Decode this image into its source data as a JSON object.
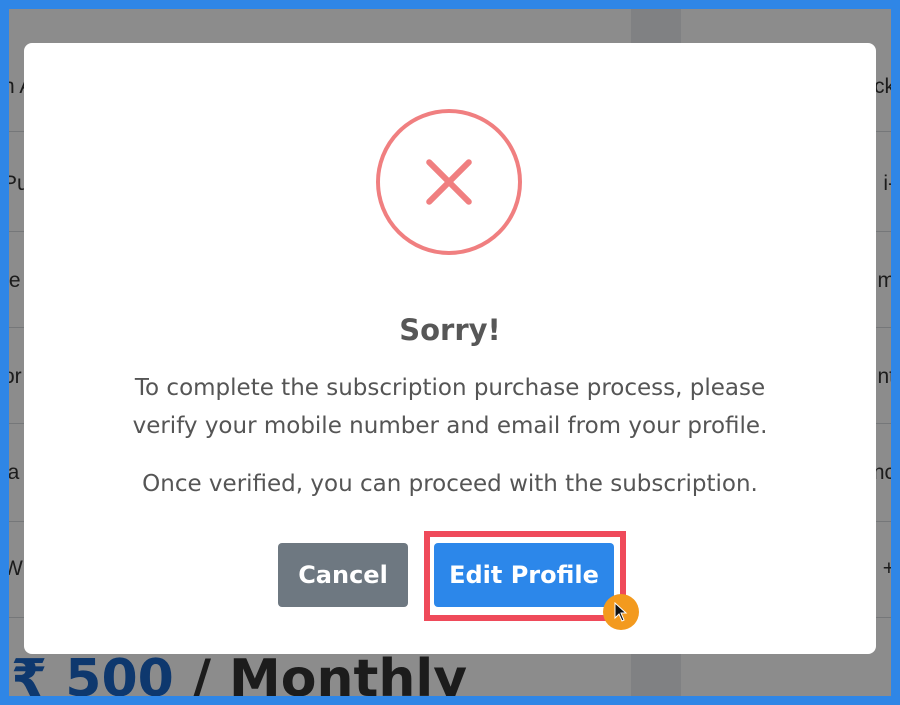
{
  "background": {
    "left_fragments": [
      "n A",
      "Pu",
      "te",
      "or",
      "ia",
      "W"
    ],
    "right_fragments": [
      "ck",
      "i-",
      "m",
      "nt",
      "nc",
      "+"
    ],
    "price": {
      "amount": "₹ 500",
      "period": " / Monthly"
    }
  },
  "dialog": {
    "icon": "error-x-icon",
    "title": "Sorry!",
    "message": "To complete the subscription purchase process, please verify your mobile number and email from your profile.",
    "note": "Once verified, you can proceed with the subscription.",
    "buttons": {
      "cancel_label": "Cancel",
      "edit_profile_label": "Edit Profile"
    }
  },
  "annotation": {
    "highlight_color": "#ef4a5a",
    "cursor_color": "#f39a1e"
  },
  "colors": {
    "frame": "#2f86e6",
    "error": "#f07f80",
    "primary": "#2c87ea",
    "secondary": "#6e7881"
  }
}
